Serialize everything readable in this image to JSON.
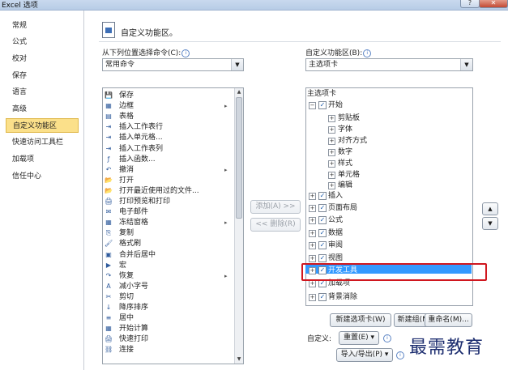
{
  "window": {
    "title": "Excel 选项",
    "help_glyph": "?",
    "close_glyph": "✕"
  },
  "nav": {
    "items": [
      "常规",
      "公式",
      "校对",
      "保存",
      "语言",
      "高级",
      "自定义功能区",
      "快速访问工具栏",
      "加载项",
      "信任中心"
    ],
    "active_index": 6
  },
  "header": {
    "title": "自定义功能区。"
  },
  "left": {
    "label": "从下列位置选择命令(C):",
    "combo_value": "常用命令",
    "commands": [
      "保存",
      "边框",
      "表格",
      "插入工作表行",
      "插入单元格...",
      "插入工作表列",
      "插入函数...",
      "撤消",
      "打开",
      "打开最近使用过的文件...",
      "打印预览和打印",
      "电子邮件",
      "冻结窗格",
      "复制",
      "格式刷",
      "合并后居中",
      "宏",
      "恢复",
      "减小字号",
      "剪切",
      "降序排序",
      "居中",
      "开始计算",
      "快速打印",
      "连接"
    ],
    "command_icons": [
      "💾",
      "▦",
      "▤",
      "⇥",
      "⇥",
      "⇥",
      "ƒ",
      "↶",
      "📂",
      "📂",
      "🖨",
      "✉",
      "▦",
      "⎘",
      "🖌",
      "▣",
      "▶",
      "↷",
      "A",
      "✂",
      "↓",
      "≡",
      "▦",
      "🖨",
      "⛓"
    ],
    "submenu_rows": [
      1,
      7,
      12,
      17
    ]
  },
  "middle": {
    "add_button": "添加(A) >>",
    "remove_button": "<< 删除(R)"
  },
  "right": {
    "label": "自定义功能区(B):",
    "combo_value": "主选项卡",
    "tree_header": "主选项卡",
    "tree": [
      {
        "label": "开始",
        "level": 0,
        "toggle": "−",
        "checked": true
      },
      {
        "label": "剪贴板",
        "level": 1,
        "toggle": "+",
        "checked": false
      },
      {
        "label": "字体",
        "level": 1,
        "toggle": "+",
        "checked": false
      },
      {
        "label": "对齐方式",
        "level": 1,
        "toggle": "+",
        "checked": false
      },
      {
        "label": "数字",
        "level": 1,
        "toggle": "+",
        "checked": false
      },
      {
        "label": "样式",
        "level": 1,
        "toggle": "+",
        "checked": false
      },
      {
        "label": "单元格",
        "level": 1,
        "toggle": "+",
        "checked": false
      },
      {
        "label": "编辑",
        "level": 1,
        "toggle": "+",
        "checked": false
      },
      {
        "label": "插入",
        "level": 0,
        "toggle": "+",
        "checked": true
      },
      {
        "label": "页面布局",
        "level": 0,
        "toggle": "+",
        "checked": true
      },
      {
        "label": "公式",
        "level": 0,
        "toggle": "+",
        "checked": true
      },
      {
        "label": "数据",
        "level": 0,
        "toggle": "+",
        "checked": true
      },
      {
        "label": "审阅",
        "level": 0,
        "toggle": "+",
        "checked": true
      },
      {
        "label": "视图",
        "level": 0,
        "toggle": "+",
        "checked": true
      },
      {
        "label": "开发工具",
        "level": 0,
        "toggle": "+",
        "checked": true,
        "selected": true
      },
      {
        "label": "加载项",
        "level": 0,
        "toggle": "+",
        "checked": true
      },
      {
        "label": "背景消除",
        "level": 0,
        "toggle": "+",
        "checked": true
      }
    ],
    "new_tab_button": "新建选项卡(W)",
    "new_group_button": "新建组(N)",
    "rename_button": "重命名(M)...",
    "customize_label": "自定义:",
    "reset_button": "重置(E) ▾",
    "import_export_button": "导入/导出(P) ▾",
    "move_up": "▲",
    "move_down": "▼"
  },
  "check_glyph": "✓",
  "submenu_glyph": "▸",
  "watermark": "最需教育",
  "colors": {
    "selection": "#3399ff",
    "active_nav": "#fbe08a",
    "annotation_box": "#d0171f"
  }
}
